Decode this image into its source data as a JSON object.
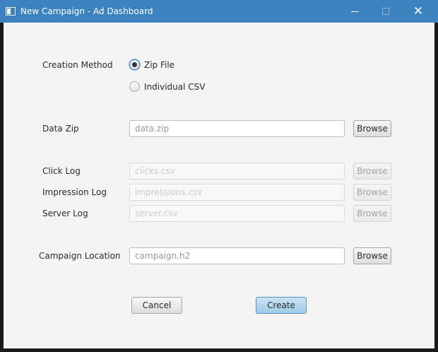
{
  "window": {
    "title": "New Campaign - Ad Dashboard",
    "controls": {
      "minimize": "minimize",
      "maximize": "maximize",
      "close": "✕"
    }
  },
  "form": {
    "creation_method": {
      "label": "Creation Method",
      "options": [
        {
          "label": "Zip File",
          "selected": true
        },
        {
          "label": "Individual CSV",
          "selected": false
        }
      ]
    },
    "data_zip": {
      "label": "Data Zip",
      "placeholder": "data.zip",
      "browse": "Browse"
    },
    "click_log": {
      "label": "Click Log",
      "placeholder": "clicks.csv",
      "browse": "Browse",
      "enabled": false
    },
    "impression_log": {
      "label": "Impression Log",
      "placeholder": "impressions.csv",
      "browse": "Browse",
      "enabled": false
    },
    "server_log": {
      "label": "Server Log",
      "placeholder": "server.csv",
      "browse": "Browse",
      "enabled": false
    },
    "campaign_location": {
      "label": "Campaign Location",
      "placeholder": "campaign.h2",
      "browse": "Browse"
    }
  },
  "actions": {
    "cancel": "Cancel",
    "create": "Create"
  },
  "colors": {
    "titlebar": "#3c82bf",
    "background": "#f4f4f4",
    "default_button": "#a9d2ee"
  }
}
